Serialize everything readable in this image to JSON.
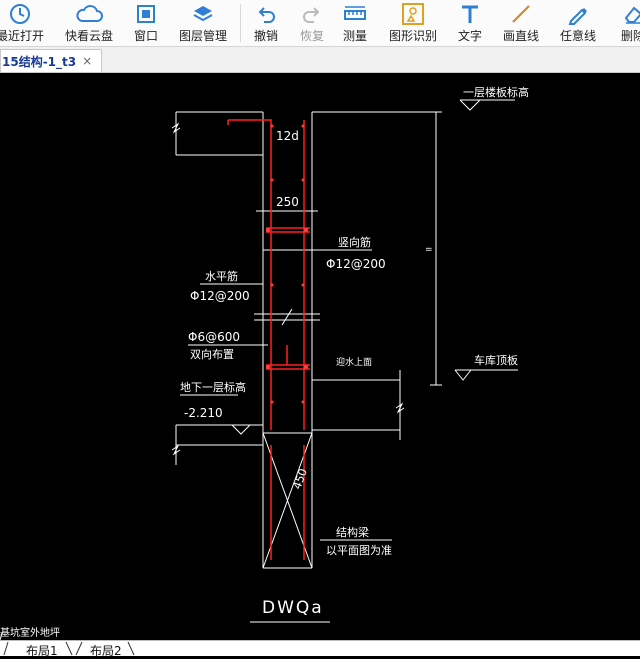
{
  "toolbar": {
    "items": [
      {
        "label": "最近打开",
        "icon": "clock-icon"
      },
      {
        "label": "快看云盘",
        "icon": "cloud-icon"
      },
      {
        "label": "窗口",
        "icon": "window-icon"
      },
      {
        "label": "图层管理",
        "icon": "layers-icon"
      },
      {
        "label": "撤销",
        "icon": "undo-icon"
      },
      {
        "label": "恢复",
        "icon": "redo-icon"
      },
      {
        "label": "测量",
        "icon": "ruler-icon"
      },
      {
        "label": "图形识别",
        "icon": "shape-recognition-icon"
      },
      {
        "label": "文字",
        "icon": "text-icon"
      },
      {
        "label": "画直线",
        "icon": "line-icon"
      },
      {
        "label": "任意线",
        "icon": "freehand-pen-icon"
      },
      {
        "label": "删除",
        "icon": "eraser-icon"
      }
    ]
  },
  "document_tab": {
    "title": "15结构-1_t3",
    "close": "×"
  },
  "drawing": {
    "top_level_label": "一层楼板标高",
    "dim_12d": "12d",
    "dim_250": "250",
    "vertical_bar_label": "竖向筋",
    "vertical_bar_spec": "Φ12@200",
    "horizontal_bar_label": "水平筋",
    "horizontal_bar_spec": "Φ12@200",
    "tie_spec": "Φ6@600",
    "tie_note": "双向布置",
    "basement_level_label": "地下一层标高",
    "basement_level_value": "-2.210",
    "waterproof_note": "迎水上面",
    "roof_label": "车库顶板",
    "dim_450": "450",
    "foundation_beam_label": "结构梁",
    "foundation_note": "以平面图为准",
    "title": "DWQa",
    "side_note": "基坑室外地坪",
    "equal_mark": "="
  },
  "layout_tabs": [
    "布局1",
    "布局2"
  ],
  "colors": {
    "rebar": "#ff2020",
    "lines": "#ffffff",
    "background": "#000000",
    "icon_blue": "#2f7fd4"
  }
}
